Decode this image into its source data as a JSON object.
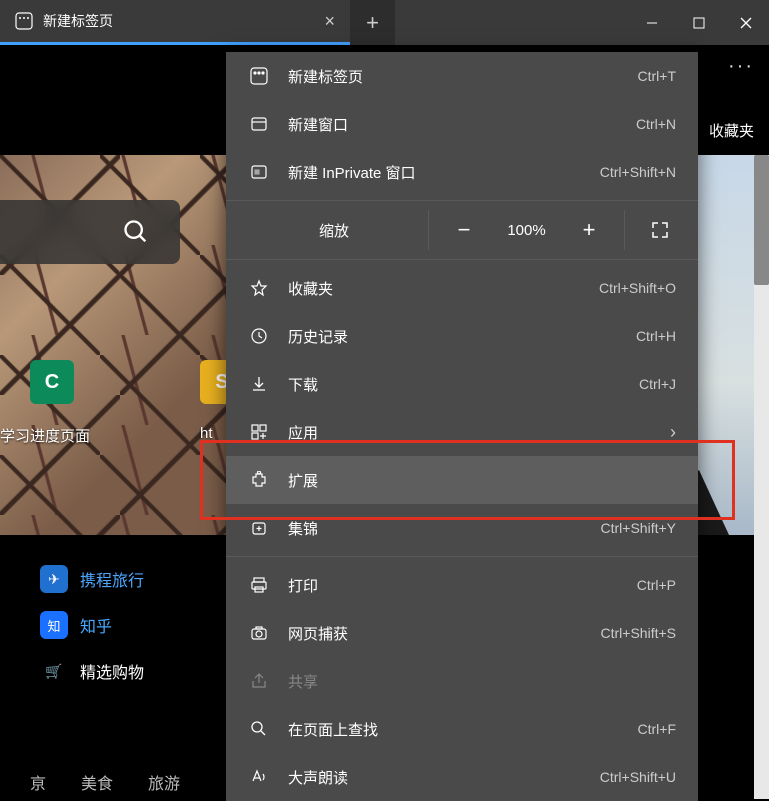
{
  "tab": {
    "title": "新建标签页"
  },
  "toolbar": {
    "favorites_label": "收藏夹"
  },
  "search_placeholder": "",
  "tiles": {
    "c_glyph": "C",
    "s_glyph": "S",
    "c_label": "学习进度页面",
    "s_label": "ht"
  },
  "links": [
    {
      "label": "携程旅行",
      "icon_bg": "#2070d0",
      "glyph": "✈"
    },
    {
      "label": "知乎",
      "icon_bg": "#1a70ff",
      "glyph": "知"
    },
    {
      "label": "精选购物",
      "icon_bg": "transparent",
      "glyph": "🛒"
    }
  ],
  "bottom_nav": [
    "亰",
    "美食",
    "旅游"
  ],
  "menu": {
    "new_tab": {
      "label": "新建标签页",
      "shortcut": "Ctrl+T"
    },
    "new_window": {
      "label": "新建窗口",
      "shortcut": "Ctrl+N"
    },
    "new_inprivate": {
      "label": "新建 InPrivate 窗口",
      "shortcut": "Ctrl+Shift+N"
    },
    "zoom": {
      "label": "缩放",
      "value": "100%"
    },
    "favorites": {
      "label": "收藏夹",
      "shortcut": "Ctrl+Shift+O"
    },
    "history": {
      "label": "历史记录",
      "shortcut": "Ctrl+H"
    },
    "downloads": {
      "label": "下载",
      "shortcut": "Ctrl+J"
    },
    "apps": {
      "label": "应用"
    },
    "extensions": {
      "label": "扩展"
    },
    "collections": {
      "label": "集锦",
      "shortcut": "Ctrl+Shift+Y"
    },
    "print": {
      "label": "打印",
      "shortcut": "Ctrl+P"
    },
    "web_capture": {
      "label": "网页捕获",
      "shortcut": "Ctrl+Shift+S"
    },
    "share": {
      "label": "共享"
    },
    "find": {
      "label": "在页面上查找",
      "shortcut": "Ctrl+F"
    },
    "read_aloud": {
      "label": "大声朗读",
      "shortcut": "Ctrl+Shift+U"
    }
  }
}
